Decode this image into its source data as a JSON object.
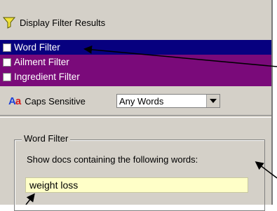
{
  "header": {
    "title": "Display Filter Results",
    "icon": "funnel-icon"
  },
  "filters": [
    {
      "label": "Word Filter",
      "selected": true,
      "checked": false
    },
    {
      "label": "Ailment Filter",
      "selected": false,
      "checked": false
    },
    {
      "label": "Ingredient Filter",
      "selected": false,
      "checked": false
    }
  ],
  "caps": {
    "icon_text_upper": "A",
    "icon_text_lower": "a",
    "label": "Caps Sensitive",
    "select_value": "Any Words"
  },
  "word_filter": {
    "group_title": "Word Filter",
    "description": "Show docs containing the following words:",
    "input_value": "weight loss"
  },
  "colors": {
    "panel": "#d4d0c8",
    "list_bg": "#7a0a7a",
    "selected_bg": "#07007f",
    "input_bg": "#ffffc8"
  }
}
